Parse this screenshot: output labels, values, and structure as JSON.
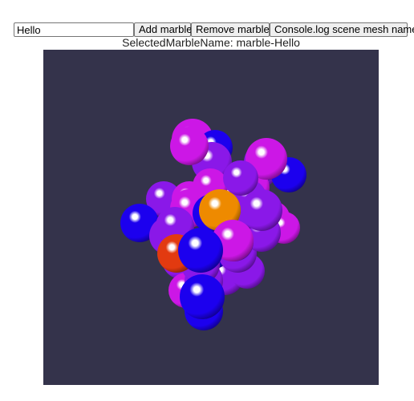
{
  "toolbar": {
    "input_value": "Hello",
    "add_label": "Add marble",
    "remove_label": "Remove marbles",
    "log_label": "Console.log scene mesh names"
  },
  "status": {
    "selected_text": "SelectedMarbleName: marble-Hello"
  },
  "scene": {
    "background_color": "#34334b",
    "marble_colors": {
      "blue": "#1c00ee",
      "violet": "#8a18e8",
      "magenta": "#cc17e6",
      "orange": "#ee8a00",
      "red": "#e23a10"
    },
    "marble_color_sequence": [
      "violet",
      "violet",
      "magenta",
      "blue",
      "blue",
      "violet",
      "violet",
      "violet",
      "magenta",
      "violet",
      "magenta",
      "magenta",
      "violet",
      "violet",
      "blue",
      "violet",
      "magenta",
      "blue",
      "violet",
      "magenta",
      "magenta",
      "violet",
      "violet",
      "magenta",
      "magenta",
      "violet",
      "blue",
      "magenta",
      "violet",
      "orange",
      "violet",
      "violet",
      "blue",
      "violet",
      "magenta",
      "violet",
      "violet",
      "violet",
      "red",
      "magenta",
      "blue",
      "blue"
    ]
  }
}
